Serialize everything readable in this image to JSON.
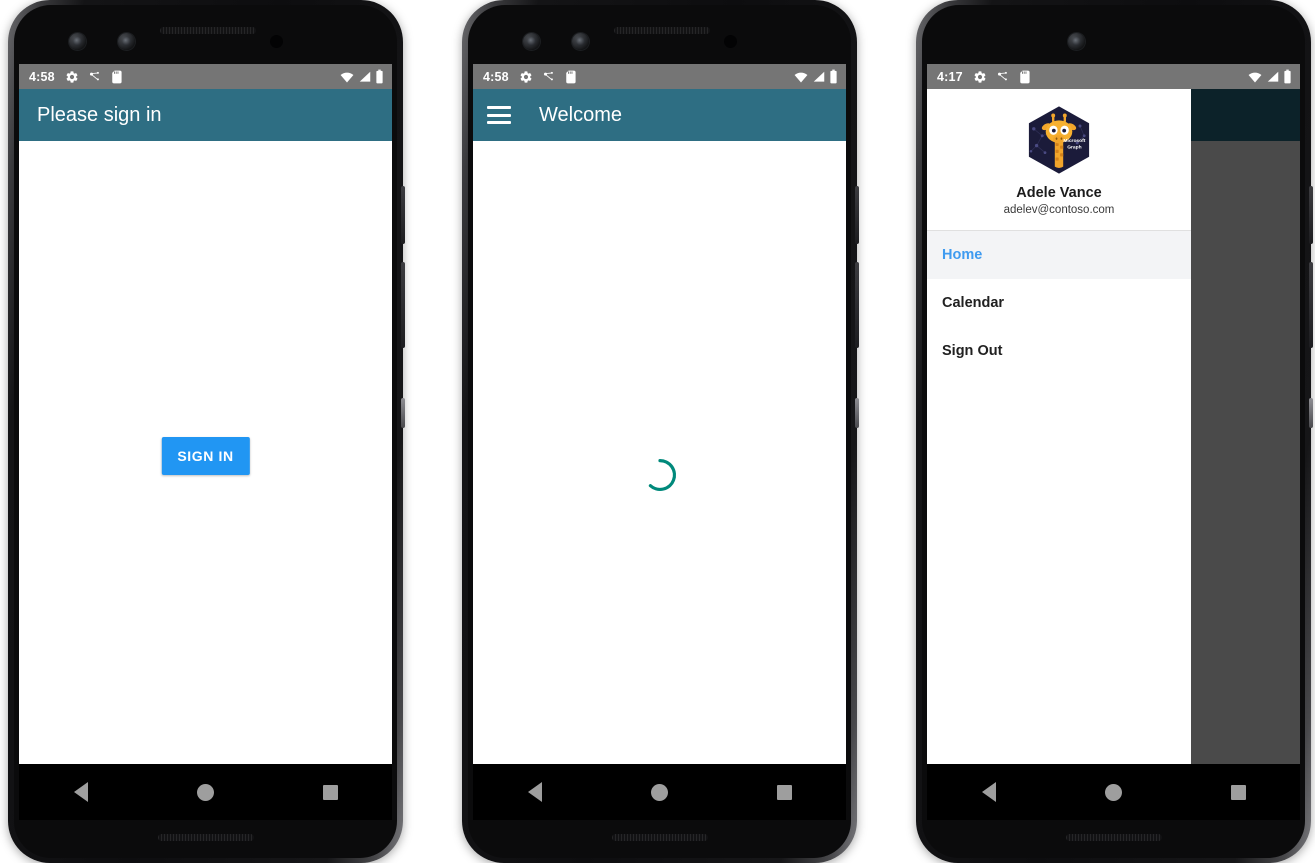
{
  "app": {
    "accent_teal": "#2E6E83",
    "accent_blue": "#2196F3",
    "spinner_color": "#00897B",
    "scrim_toolbar": "#0C2229",
    "scrim_body": "#4a4a4a",
    "statusbar_color": "#757575"
  },
  "phones": [
    {
      "id": "signin-screen",
      "status_bar": {
        "time": "4:58",
        "left_icons": [
          "gear-icon",
          "debug-dots-icon",
          "sdcard-icon"
        ],
        "right_icons": [
          "wifi-icon",
          "cellular-signal-icon",
          "battery-icon"
        ]
      },
      "toolbar": {
        "title": "Please sign in",
        "has_menu": false
      },
      "content": {
        "button_label": "SIGN IN"
      },
      "nav_bar": [
        "back-button",
        "home-button",
        "recents-button"
      ]
    },
    {
      "id": "welcome-screen",
      "status_bar": {
        "time": "4:58",
        "left_icons": [
          "gear-icon",
          "debug-dots-icon",
          "sdcard-icon"
        ],
        "right_icons": [
          "wifi-icon",
          "cellular-signal-icon",
          "battery-icon"
        ]
      },
      "toolbar": {
        "title": "Welcome",
        "has_menu": true,
        "menu_label": "Open navigation drawer"
      },
      "content": {
        "loading": "loading-spinner"
      },
      "nav_bar": [
        "back-button",
        "home-button",
        "recents-button"
      ]
    },
    {
      "id": "drawer-screen",
      "status_bar": {
        "time": "4:17",
        "left_icons": [
          "gear-icon",
          "debug-dots-icon",
          "sdcard-icon"
        ],
        "right_icons": [
          "wifi-icon",
          "cellular-signal-icon",
          "battery-icon"
        ]
      },
      "drawer": {
        "avatar_alt": "microsoft-graph-giraffe-avatar",
        "user_name": "Adele Vance",
        "user_email": "adelev@contoso.com",
        "items": [
          {
            "label": "Home",
            "selected": true
          },
          {
            "label": "Calendar",
            "selected": false
          },
          {
            "label": "Sign Out",
            "selected": false
          }
        ]
      },
      "nav_bar": [
        "back-button",
        "home-button",
        "recents-button"
      ]
    }
  ]
}
